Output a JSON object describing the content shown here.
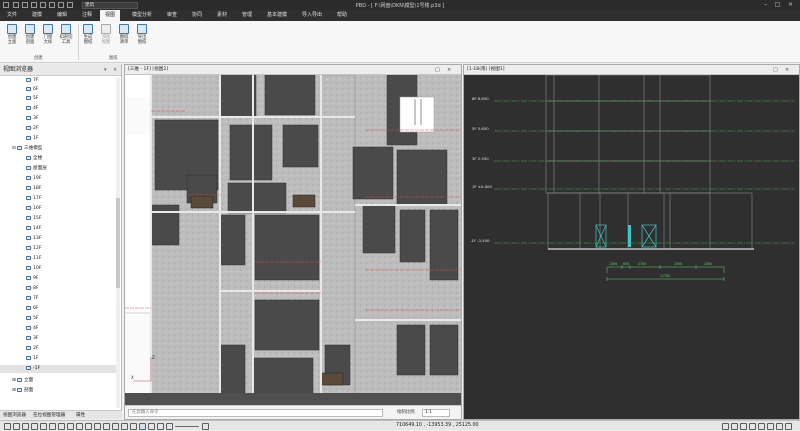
{
  "window": {
    "title": "PBD - [ F:\\网盘\\DKN\\模型\\1号楼.p3d ]",
    "project_combo": "建筑"
  },
  "menu": {
    "tabs": [
      "文件",
      "建模",
      "编辑",
      "注释",
      "视图",
      "模型分析",
      "审查",
      "协同",
      "素材",
      "管理",
      "基本建模",
      "导入导出",
      "帮助"
    ],
    "active": "视图"
  },
  "ribbon": {
    "buttons": [
      {
        "l1": "创建",
        "l2": "立面"
      },
      {
        "l1": "创建",
        "l2": "剖面"
      },
      {
        "l1": "门窗",
        "l2": "大样"
      },
      {
        "l1": "扣剖切",
        "l2": "工具"
      },
      {
        "l1": "生成",
        "l2": "图纸"
      },
      {
        "l1": "添加",
        "l2": "视图"
      },
      {
        "l1": "图纸",
        "l2": "清单"
      },
      {
        "l1": "导出",
        "l2": "图纸"
      }
    ],
    "groups": [
      "创建",
      "图纸"
    ]
  },
  "browser": {
    "title": "视图浏览器",
    "items": [
      "7F",
      "6F",
      "5F",
      "4F",
      "3F",
      "2F",
      "1F",
      "三维模型",
      "全楼",
      "屋面层",
      "19F",
      "18F",
      "17F",
      "16F",
      "15F",
      "14F",
      "13F",
      "12F",
      "11F",
      "10F",
      "9F",
      "8F",
      "7F",
      "6F",
      "5F",
      "4F",
      "3F",
      "2F",
      "1F",
      "-1F",
      "立面",
      "剖面"
    ]
  },
  "bottom_tabs": [
    "视图浏览器",
    "在位视图管理器",
    "属性"
  ],
  "viewport_left": {
    "title": "[三维 - 1F] [视图2]"
  },
  "viewport_right": {
    "title": "[1-18(南) [视图1]"
  },
  "levels": [
    "6F 8.850",
    "5F 5.650",
    "3F 2.550",
    "1F ±0.000",
    "-1F -3.400"
  ],
  "dimensions": {
    "parts": [
      "1300",
      "600",
      "2700",
      "2300",
      "1000"
    ],
    "total": "11700"
  },
  "command": {
    "placeholder": "在此输入命令",
    "scale_label": "绘制比例",
    "scale_value": "1:1"
  },
  "status": {
    "coords": "710649.10 , -13953.39 , 25125.00"
  },
  "colors": {
    "ribbon_bg": "#f7f7f7",
    "dark_bg": "#2f2f2f",
    "level_green": "#3fbf3f",
    "door_cyan": "#3cc8c8"
  }
}
